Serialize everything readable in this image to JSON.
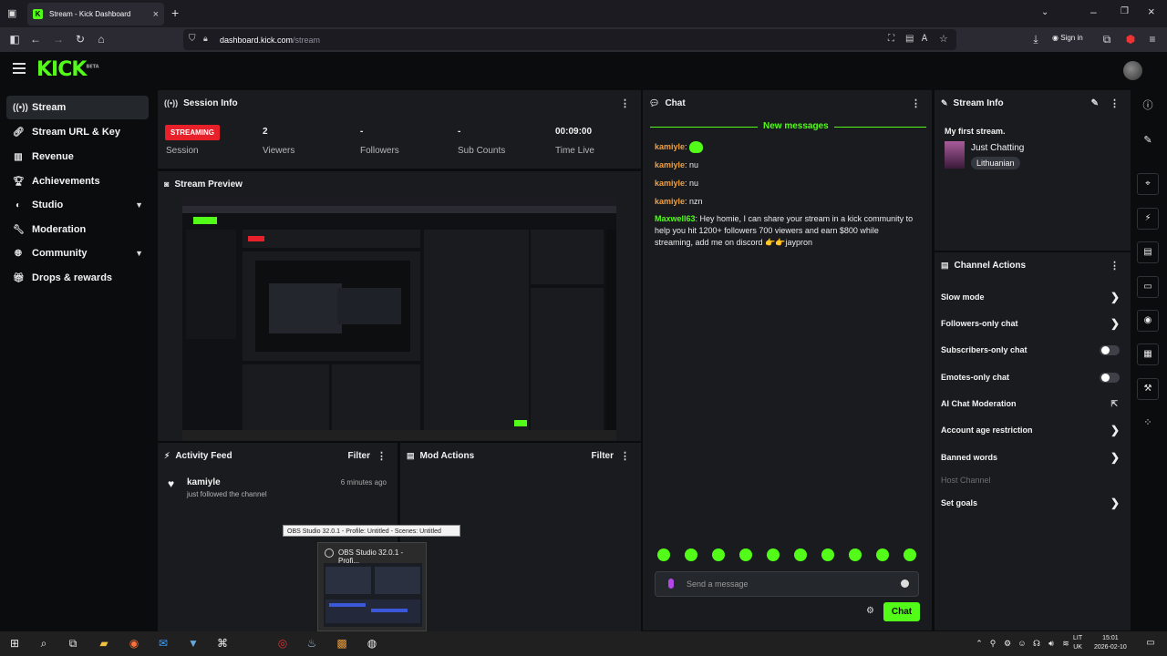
{
  "browser": {
    "tab_title": "Stream - Kick Dashboard",
    "url_domain": "dashboard.kick.com",
    "url_path": "/stream",
    "sign_in": "Sign in"
  },
  "app": {
    "logo": "KICK",
    "logo_badge": "BETA"
  },
  "sidebar": {
    "items": [
      {
        "label": "Stream",
        "icon": "broadcast-icon"
      },
      {
        "label": "Stream URL & Key",
        "icon": "link-icon"
      },
      {
        "label": "Revenue",
        "icon": "revenue-icon"
      },
      {
        "label": "Achievements",
        "icon": "trophy-icon"
      },
      {
        "label": "Studio",
        "icon": "palette-icon"
      },
      {
        "label": "Moderation",
        "icon": "wrench-icon"
      },
      {
        "label": "Community",
        "icon": "globe-icon"
      },
      {
        "label": "Drops & rewards",
        "icon": "gift-icon"
      }
    ]
  },
  "session": {
    "title": "Session Info",
    "status": "STREAMING",
    "status_label": "Session",
    "viewers_value": "2",
    "viewers_label": "Viewers",
    "followers_value": "-",
    "followers_label": "Followers",
    "subs_value": "-",
    "subs_label": "Sub Counts",
    "time_value": "00:09:00",
    "time_label": "Time Live"
  },
  "preview": {
    "title": "Stream Preview"
  },
  "activity": {
    "title": "Activity Feed",
    "filter": "Filter",
    "items": [
      {
        "name": "kamiyle",
        "text": "just followed the channel",
        "time": "6 minutes ago"
      }
    ]
  },
  "mod_actions": {
    "title": "Mod Actions",
    "filter": "Filter"
  },
  "chat": {
    "title": "Chat",
    "new_messages": "New messages",
    "messages": [
      {
        "user": "kamiyle",
        "text": ":"
      },
      {
        "user": "kamiyle",
        "text": ": nu"
      },
      {
        "user": "kamiyle",
        "text": ": nu"
      },
      {
        "user": "kamiyle",
        "text": ": nzn"
      },
      {
        "user": "Maxwell63",
        "text": ": Hey homie, I can share your stream in a kick community to help you hit 1200+ followers 700 viewers and earn $800 while streaming, add me on discord 👉👉jaypron"
      }
    ],
    "input_placeholder": "Send a message",
    "send_label": "Chat"
  },
  "stream_info": {
    "title": "Stream Info",
    "stream_title": "My first stream.",
    "category": "Just Chatting",
    "tag": "Lithuanian"
  },
  "channel_actions": {
    "title": "Channel Actions",
    "items": [
      {
        "label": "Slow mode",
        "control": "chevron"
      },
      {
        "label": "Followers-only chat",
        "control": "chevron"
      },
      {
        "label": "Subscribers-only chat",
        "control": "toggle",
        "state": "off"
      },
      {
        "label": "Emotes-only chat",
        "control": "toggle",
        "state": "off"
      },
      {
        "label": "AI Chat Moderation",
        "control": "external"
      },
      {
        "label": "Account age restriction",
        "control": "chevron"
      },
      {
        "label": "Banned words",
        "control": "chevron"
      },
      {
        "label": "Host Channel",
        "control": "none",
        "disabled": true
      },
      {
        "label": "Set goals",
        "control": "chevron"
      }
    ]
  },
  "obs": {
    "tooltip": "OBS Studio 32.0.1 - Profile: Untitled - Scenes: Untitled",
    "title": "OBS Studio 32.0.1 - Profi..."
  },
  "taskbar": {
    "lang1": "LIT",
    "lang2": "UK",
    "time": "15:01",
    "date": "2026-02-10"
  },
  "colors": {
    "accent": "#53fc18",
    "streaming": "#e8202a",
    "username": "#f0a040"
  }
}
